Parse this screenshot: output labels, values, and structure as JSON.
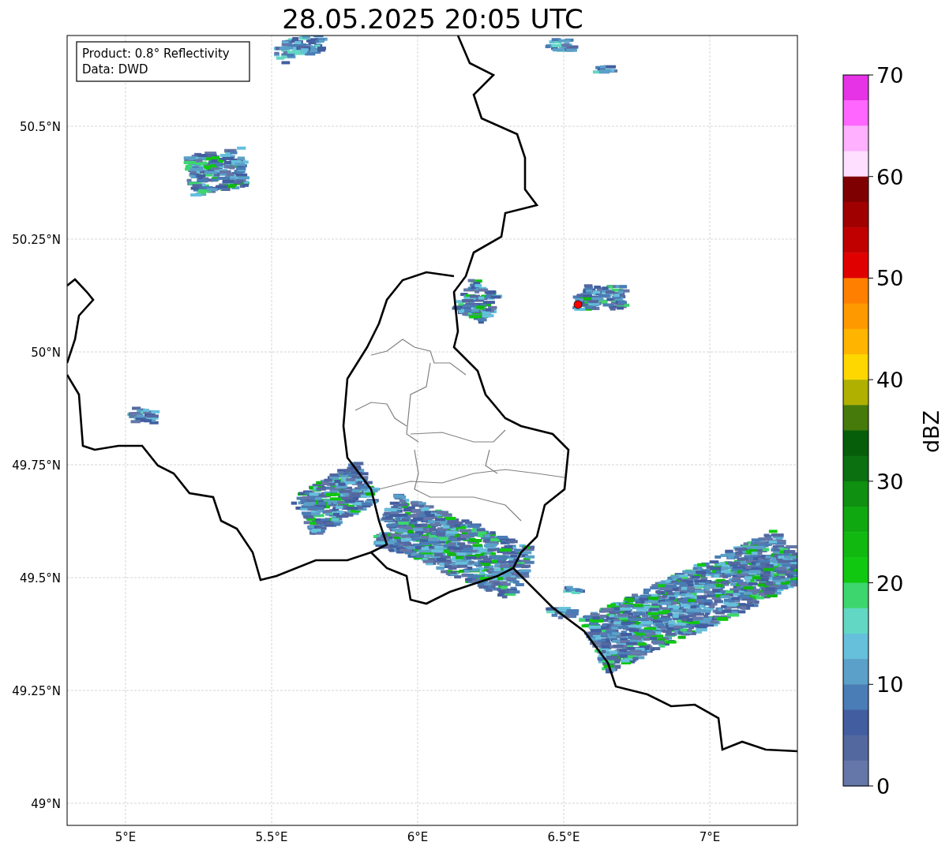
{
  "title": "28.05.2025 20:05 UTC",
  "info_box": [
    "Product: 0.8° Reflectivity",
    "Data: DWD"
  ],
  "map": {
    "lon_ticks": [
      "5°E",
      "5.5°E",
      "6°E",
      "6.5°E",
      "7°E"
    ],
    "lat_ticks": [
      "50.5°N",
      "50.25°N",
      "50°N",
      "49.75°N",
      "49.5°N",
      "49.25°N",
      "49°N"
    ]
  },
  "colorbar": {
    "label": "dBZ",
    "ticks": [
      "70",
      "60",
      "50",
      "40",
      "30",
      "20",
      "10",
      "0"
    ],
    "bins": [
      {
        "color": "#e633e6"
      },
      {
        "color": "#ff66ff"
      },
      {
        "color": "#ffb0ff"
      },
      {
        "color": "#ffdfff"
      },
      {
        "color": "#7f0000"
      },
      {
        "color": "#a00000"
      },
      {
        "color": "#c00000"
      },
      {
        "color": "#e00000"
      },
      {
        "color": "#ff7f00"
      },
      {
        "color": "#ff9900"
      },
      {
        "color": "#ffb400"
      },
      {
        "color": "#ffd700"
      },
      {
        "color": "#b0b000"
      },
      {
        "color": "#467a0a"
      },
      {
        "color": "#075e0a"
      },
      {
        "color": "#0a7010"
      },
      {
        "color": "#0f9010"
      },
      {
        "color": "#10a810"
      },
      {
        "color": "#10b810"
      },
      {
        "color": "#10c810"
      },
      {
        "color": "#3dd66e"
      },
      {
        "color": "#62d8c4"
      },
      {
        "color": "#66c0dc"
      },
      {
        "color": "#5aa0c8"
      },
      {
        "color": "#4a7cb5"
      },
      {
        "color": "#425ea0"
      },
      {
        "color": "#5468a0"
      },
      {
        "color": "#6477a8"
      }
    ]
  }
}
